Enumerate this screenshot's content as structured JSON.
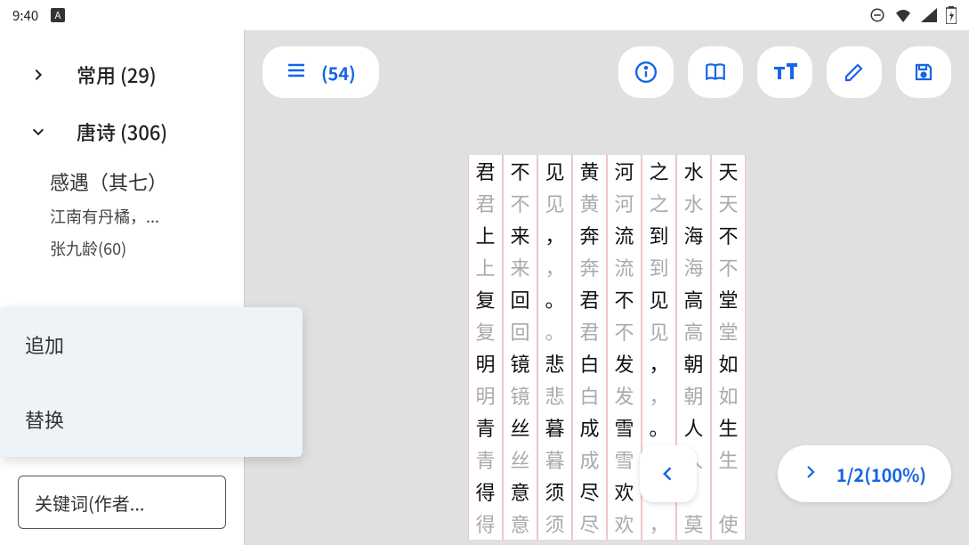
{
  "statusbar": {
    "time": "9:40"
  },
  "sidebar": {
    "categories": [
      {
        "label": "常用 (29)",
        "expanded": false
      },
      {
        "label": "唐诗 (306)",
        "expanded": true
      }
    ],
    "poem": {
      "title": "感遇（其七）",
      "preview": "江南有丹橘，...",
      "author": "张九龄(60)"
    },
    "search_placeholder": "关键词(作者..."
  },
  "popup": {
    "items": [
      "追加",
      "替换"
    ]
  },
  "toolbar": {
    "count": "(54)"
  },
  "progress": {
    "label": "1/2(100%)"
  },
  "chart_data": {
    "type": "table",
    "description": "汉字书法练习格子，每行8字，显示原文(trace)与淡灰参考(ghost)",
    "rows": [
      {
        "trace": [
          "君",
          "不",
          "见",
          "黄",
          "河",
          "之",
          "水",
          "天"
        ],
        "ghost": [
          "君",
          "不",
          "见",
          "黄",
          "河",
          "之",
          "水",
          "天"
        ]
      },
      {
        "trace": [
          "上",
          "来",
          "，",
          "奔",
          "流",
          "到",
          "海",
          "不"
        ],
        "ghost": [
          "上",
          "来",
          "，",
          "奔",
          "流",
          "到",
          "海",
          "不"
        ]
      },
      {
        "trace": [
          "复",
          "回",
          "。",
          "君",
          "不",
          "见",
          "高",
          "堂"
        ],
        "ghost": [
          "复",
          "回",
          "。",
          "君",
          "不",
          "见",
          "高",
          "堂"
        ]
      },
      {
        "trace": [
          "明",
          "镜",
          "悲",
          "白",
          "发",
          "，",
          "朝",
          "如"
        ],
        "ghost": [
          "明",
          "镜",
          "悲",
          "白",
          "发",
          "，",
          "朝",
          "如"
        ]
      },
      {
        "trace": [
          "青",
          "丝",
          "暮",
          "成",
          "雪",
          "。",
          "人",
          "生"
        ],
        "ghost": [
          "青",
          "丝",
          "暮",
          "成",
          "雪",
          "。",
          "人",
          "生"
        ]
      },
      {
        "trace": [
          "得",
          "意",
          "须",
          "尽",
          "欢",
          "，",
          "",
          ""
        ],
        "ghost": [
          "得",
          "意",
          "须",
          "尽",
          "欢",
          "，",
          "莫",
          "使"
        ]
      }
    ]
  }
}
